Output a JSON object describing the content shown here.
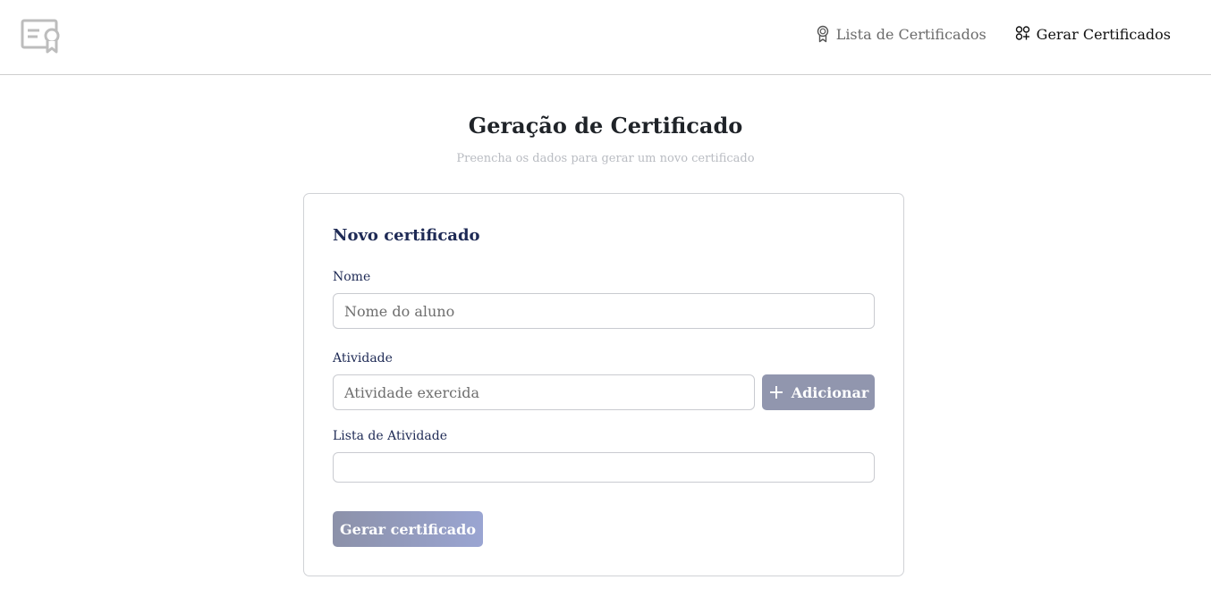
{
  "header": {
    "logo_icon": "certificate-icon",
    "nav": [
      {
        "label": "Lista de Certificados",
        "icon": "award-ribbon-icon"
      },
      {
        "label": "Gerar Certificados",
        "icon": "grid-plus-icon"
      }
    ]
  },
  "page": {
    "title": "Geração de Certificado",
    "subtitle": "Preencha os dados para gerar um novo certificado"
  },
  "form": {
    "card_title": "Novo certificado",
    "name_label": "Nome",
    "name_placeholder": "Nome do aluno",
    "activity_label": "Atividade",
    "activity_placeholder": "Atividade exercida",
    "add_button": "Adicionar",
    "list_label": "Lista de Atividade",
    "submit_button": "Gerar certificado"
  },
  "colors": {
    "primary_text": "#1e2a55",
    "button_bg": "#9196ae",
    "border": "#c9cbd0"
  }
}
